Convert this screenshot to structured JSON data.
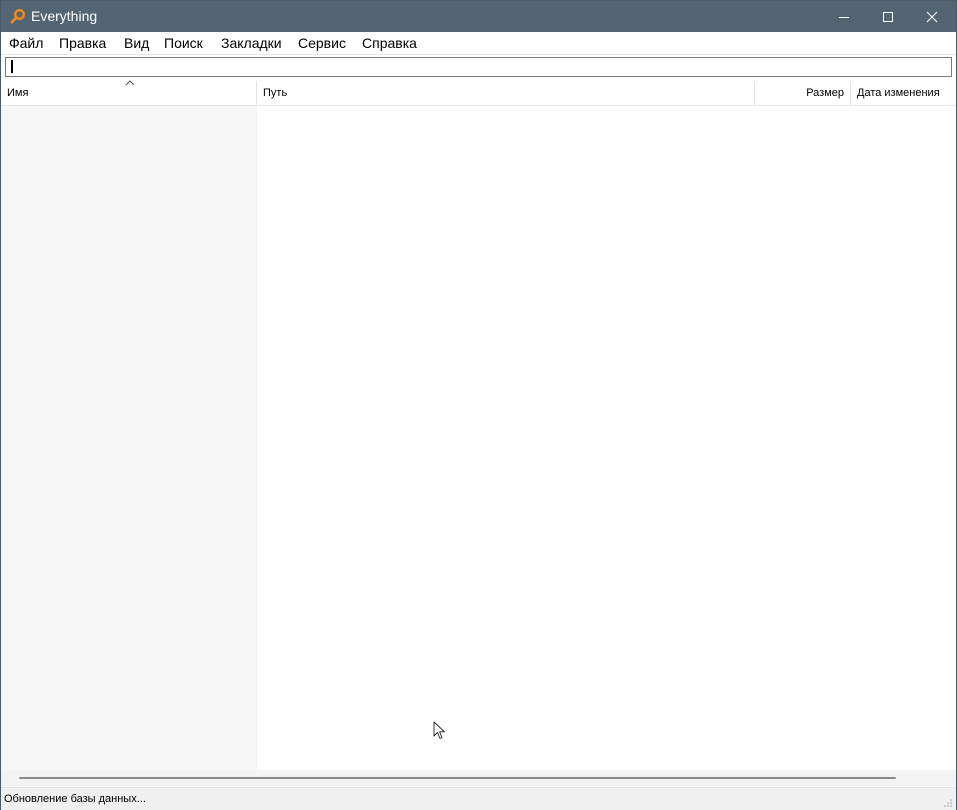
{
  "window": {
    "title": "Everything",
    "titlebar_color": "#536473",
    "app_icon": "magnifier-icon",
    "controls": [
      "minimize-icon",
      "maximize-icon",
      "close-icon"
    ]
  },
  "menu": {
    "items": [
      "Файл",
      "Правка",
      "Вид",
      "Поиск",
      "Закладки",
      "Сервис",
      "Справка"
    ]
  },
  "search": {
    "value": "",
    "placeholder": ""
  },
  "columns": {
    "name": "Имя",
    "path": "Путь",
    "size": "Размер",
    "date": "Дата изменения",
    "sorted_by": "name",
    "sort_direction": "ascending"
  },
  "results": [],
  "status": {
    "text": "Обновление базы данных..."
  }
}
